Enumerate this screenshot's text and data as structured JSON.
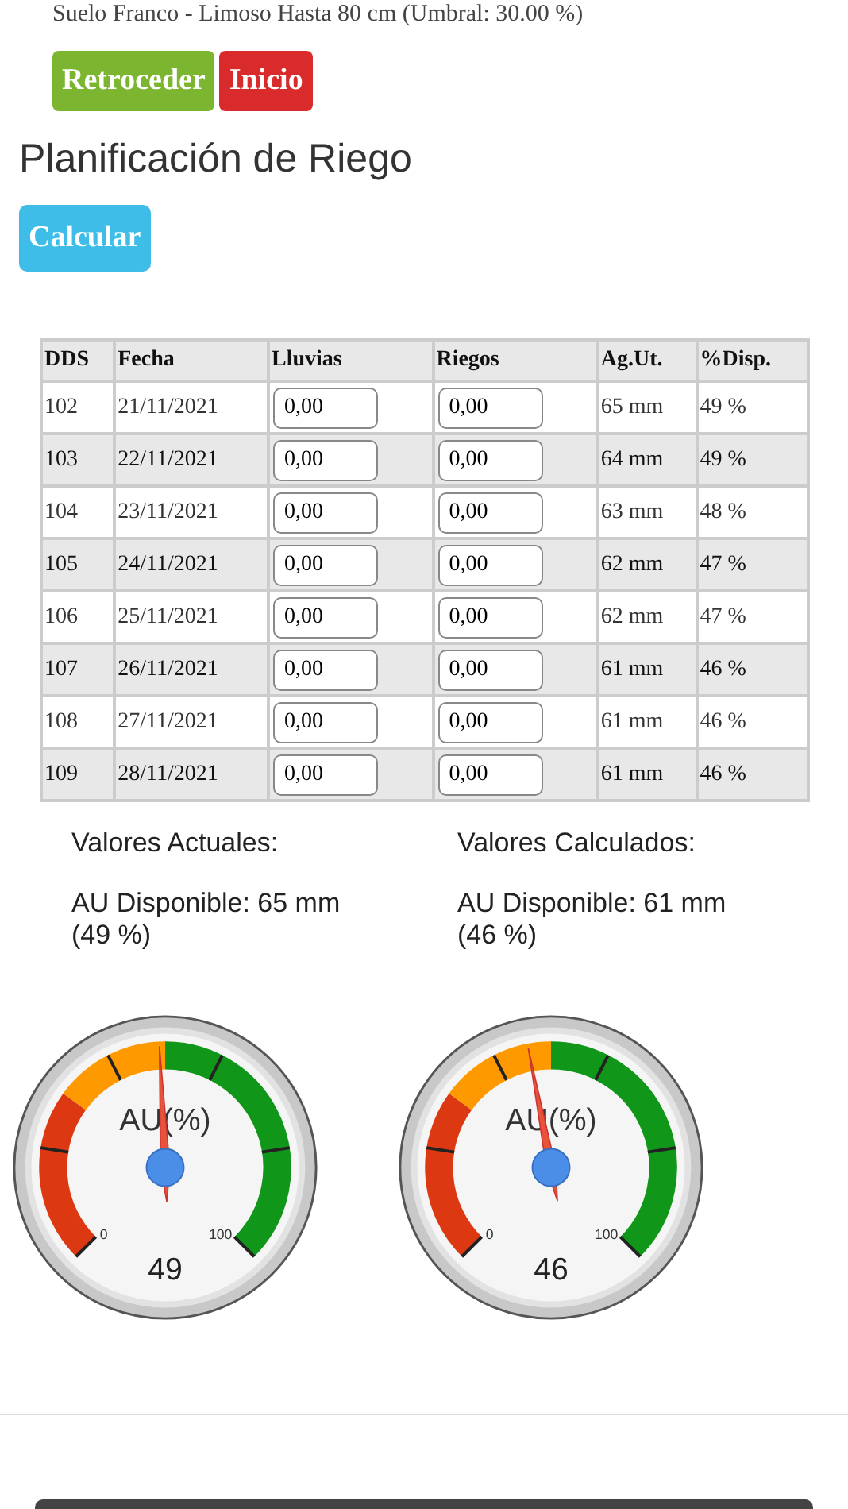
{
  "soil_info": "Suelo Franco - Limoso Hasta 80 cm (Umbral: 30.00 %)",
  "nav_buttons": [
    {
      "label": "Retroceder",
      "kind": "back"
    },
    {
      "label": "Inicio",
      "kind": "home"
    }
  ],
  "title": "Planificación de Riego",
  "calculate_button": "Calcular",
  "table": {
    "columns": [
      "DDS",
      "Fecha",
      "Lluvias",
      "Riegos",
      "Ag.Ut.",
      "%Disp."
    ],
    "rows": [
      {
        "dds": "102",
        "fecha": "21/11/2021",
        "lluvias": "0,00",
        "riegos": "0,00",
        "ag_ut": "65 mm",
        "disp": "49 %"
      },
      {
        "dds": "103",
        "fecha": "22/11/2021",
        "lluvias": "0,00",
        "riegos": "0,00",
        "ag_ut": "64 mm",
        "disp": "49 %"
      },
      {
        "dds": "104",
        "fecha": "23/11/2021",
        "lluvias": "0,00",
        "riegos": "0,00",
        "ag_ut": "63 mm",
        "disp": "48 %"
      },
      {
        "dds": "105",
        "fecha": "24/11/2021",
        "lluvias": "0,00",
        "riegos": "0,00",
        "ag_ut": "62 mm",
        "disp": "47 %"
      },
      {
        "dds": "106",
        "fecha": "25/11/2021",
        "lluvias": "0,00",
        "riegos": "0,00",
        "ag_ut": "62 mm",
        "disp": "47 %"
      },
      {
        "dds": "107",
        "fecha": "26/11/2021",
        "lluvias": "0,00",
        "riegos": "0,00",
        "ag_ut": "61 mm",
        "disp": "46 %"
      },
      {
        "dds": "108",
        "fecha": "27/11/2021",
        "lluvias": "0,00",
        "riegos": "0,00",
        "ag_ut": "61 mm",
        "disp": "46 %"
      },
      {
        "dds": "109",
        "fecha": "28/11/2021",
        "lluvias": "0,00",
        "riegos": "0,00",
        "ag_ut": "61 mm",
        "disp": "46 %"
      }
    ]
  },
  "summaries": [
    {
      "heading": "Valores Actuales:",
      "text": "AU Disponible: 65 mm (49 %)",
      "gauge": {
        "title": "AU(%)",
        "min_label": "0",
        "max_label": "100",
        "value": "49"
      }
    },
    {
      "heading": "Valores Calculados:",
      "text": "AU Disponible: 61 mm (46 %)",
      "gauge": {
        "title": "AU(%)",
        "min_label": "0",
        "max_label": "100",
        "value": "46"
      }
    }
  ]
}
